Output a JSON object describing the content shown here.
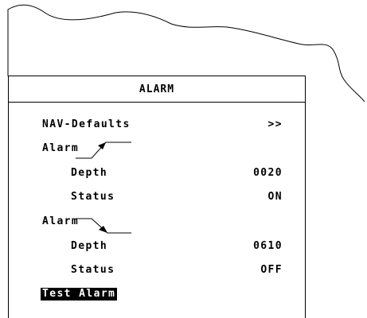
{
  "panel": {
    "title": "ALARM",
    "items": [
      {
        "label": "NAV-Defaults",
        "value": ">>"
      },
      {
        "label": "Alarm",
        "value": "",
        "indicator": "arrow-up-icon"
      },
      {
        "label": "Depth",
        "value": "0020"
      },
      {
        "label": "Status",
        "value": "ON"
      },
      {
        "label": "Alarm",
        "value": "",
        "indicator": "arrow-down-icon"
      },
      {
        "label": "Depth",
        "value": "0610"
      },
      {
        "label": "Status",
        "value": "OFF"
      },
      {
        "label": "Test Alarm",
        "value": "",
        "selected": true
      }
    ]
  },
  "colors": {
    "background": "#ffffff",
    "foreground": "#000000",
    "highlight": "#000000"
  }
}
